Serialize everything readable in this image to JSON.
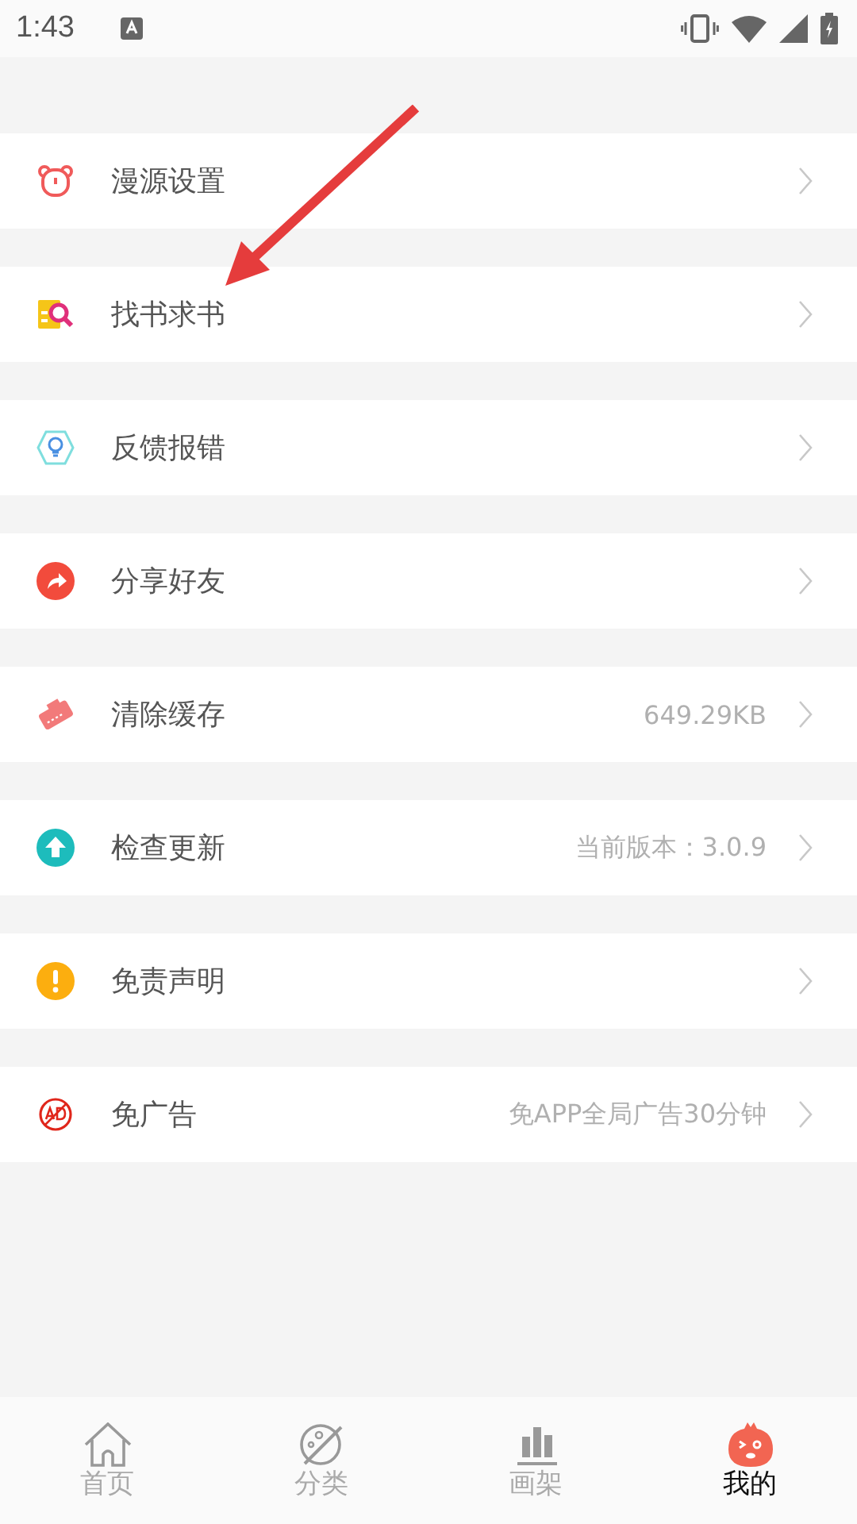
{
  "status_bar": {
    "time": "1:43"
  },
  "menu_items": [
    {
      "label": "漫源设置"
    },
    {
      "label": "找书求书"
    },
    {
      "label": "反馈报错"
    },
    {
      "label": "分享好友"
    },
    {
      "label": "清除缓存",
      "value": "649.29KB"
    },
    {
      "label": "检查更新",
      "value": "当前版本：3.0.9"
    },
    {
      "label": "免责声明"
    },
    {
      "label": "免广告",
      "value": "免APP全局广告30分钟"
    }
  ],
  "bottom_nav": [
    {
      "label": "首页",
      "selected": false
    },
    {
      "label": "分类",
      "selected": false
    },
    {
      "label": "画架",
      "selected": false
    },
    {
      "label": "我的",
      "selected": true
    }
  ]
}
